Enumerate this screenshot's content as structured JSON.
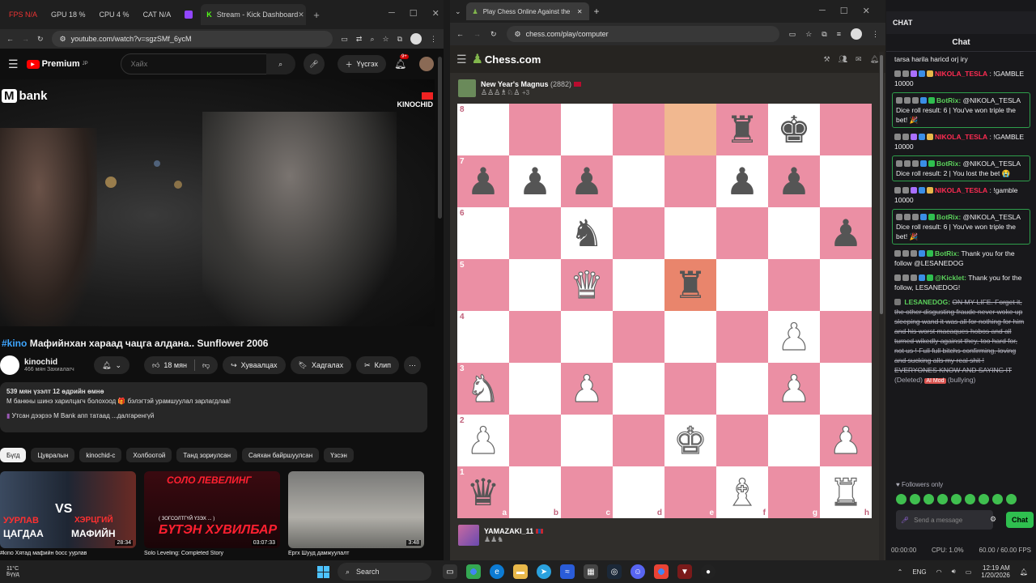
{
  "left_browser": {
    "tabs": [
      "FPS N/A",
      "GPU 18 %",
      "CPU 4 %",
      "CAT N/A",
      "",
      "Stream - Kick Dashboard"
    ],
    "url": "youtube.com/watch?v=sgzSMf_6ycM",
    "yt_logo": "Premium",
    "yt_logo_sup": "JP",
    "search_placeholder": "Хайх",
    "create_label": "Үүсгэх",
    "notif_count": "9+"
  },
  "video": {
    "overlay_brand": "bank",
    "overlay_brand_m": "M",
    "overlay_kinochid": "KINOCHID",
    "hashtag": "#kino",
    "title": "Мафийнхан хараад чацга алдана.. Sunflower 2006",
    "channel": "kinochid",
    "subs": "466 мян Захиалагч",
    "likes": "18 мян",
    "share": "Хуваалцах",
    "save": "Хадгалах",
    "clip": "Клип",
    "views_line": "539 мян үзэлт  12 өдрийн өмнө",
    "desc_line1": "М банкны шинэ харилцагч болохоод 🎁 бэлэгтэй урамшуулал зарлагдлаа!",
    "desc_line2": "Утсан дээрээ M Bank апп татаад ...далгаренгүй"
  },
  "chips": [
    "Бүгд",
    "Цувралын",
    "kinochid-с",
    "Холбоотой",
    "Танд зориулсан",
    "Саяхан байршуулсан",
    "Үзсэн"
  ],
  "thumbs": [
    {
      "title": "#kino Хятад мафийн босс уурлав",
      "duration": "28:34",
      "t1": "УУРЛАВ",
      "t2": "ХЭРЦГИЙ",
      "t3": "ЦАГДАА",
      "t4": "МАФИЙН",
      "vs": "VS"
    },
    {
      "title": "Solo Leveling: Completed Story",
      "duration": "03:07:33",
      "t1": "СОЛО ЛЕВЕЛИНГ",
      "t2": "БҮТЭН ХУВИЛБАР",
      "t3": "( ЗОГСОЛТГҮЙ ҮЗЭХ ... )"
    },
    {
      "title": "Ергх Шууд дамжуулалт",
      "duration": "3:48"
    }
  ],
  "chess_browser": {
    "tab_title": "Play Chess Online Against the C",
    "url": "chess.com/play/computer",
    "logo": "Chess.com",
    "opponent": "New Year's Magnus",
    "opponent_rating": "(2882)",
    "opponent_captures": "+3",
    "player": "YAMAZAKI_11"
  },
  "board": [
    [
      "",
      "",
      "",
      "",
      "hl",
      "bR",
      "bK",
      ""
    ],
    [
      "bP",
      "bP",
      "bP",
      "",
      "",
      "bP",
      "bP",
      ""
    ],
    [
      "",
      "",
      "bN",
      "",
      "",
      "",
      "",
      "bP"
    ],
    [
      "",
      "",
      "wQ",
      "",
      "bR",
      "",
      "",
      ""
    ],
    [
      "",
      "",
      "",
      "",
      "",
      "",
      "wP",
      ""
    ],
    [
      "wN",
      "",
      "wP",
      "",
      "",
      "",
      "wP",
      ""
    ],
    [
      "wP",
      "",
      "",
      "",
      "wK",
      "",
      "",
      "wP"
    ],
    [
      "bQ",
      "",
      "",
      "",
      "",
      "wB",
      "",
      "wR"
    ]
  ],
  "files": [
    "a",
    "b",
    "c",
    "d",
    "e",
    "f",
    "g",
    "h"
  ],
  "ranks": [
    "8",
    "7",
    "6",
    "5",
    "4",
    "3",
    "2",
    "1"
  ],
  "chat": {
    "header": "CHAT",
    "title": "Chat",
    "messages": [
      {
        "name": "",
        "text": "tarsa harila haricd orj iry",
        "highlight": false,
        "kind": "n"
      },
      {
        "name": "NIKOLA_TESLA",
        "text": ": !GAMBLE 10000",
        "highlight": false,
        "kind": "n"
      },
      {
        "name": "BotRix:",
        "text": "@NIKOLA_TESLA Dice roll result: 6 | You've won triple the bet! 🎉",
        "highlight": true,
        "kind": "b"
      },
      {
        "name": "NIKOLA_TESLA",
        "text": ": !GAMBLE 10000",
        "highlight": false,
        "kind": "n"
      },
      {
        "name": "BotRix:",
        "text": "@NIKOLA_TESLA Dice roll result: 2 | You lost the bet 😭",
        "highlight": true,
        "kind": "b"
      },
      {
        "name": "NIKOLA_TESLA",
        "text": ": !gamble 10000",
        "highlight": false,
        "kind": "n"
      },
      {
        "name": "BotRix:",
        "text": "@NIKOLA_TESLA Dice roll result: 6 | You've won triple the bet! 🎉",
        "highlight": true,
        "kind": "b"
      },
      {
        "name": "BotRix:",
        "text": "Thank you for the follow @LESANEDOG",
        "highlight": false,
        "kind": "b"
      },
      {
        "name": "@Kicklet:",
        "text": "Thank you for the follow, LESANEDOG!",
        "highlight": false,
        "kind": "k"
      }
    ],
    "deleted_name": "LESANEDOG:",
    "deleted_text": "ON MY LIFE. Forget it, the other disgusting fraude never woke up sleeping wand it was all for nothing for him and his worst macaques hobos and all turned wikedly against they, too hard for, not us ! Full full bitchs confirming, loving and sucking alls my real shit ! EVERYONES KNOW AND SAYING IT",
    "deleted_tag": "(Deleted)",
    "mod_tag": "AI Mod",
    "mod_reason": "(bullying)",
    "followers_only": "Followers only",
    "input_placeholder": "Send a message",
    "send_label": "Chat",
    "time": "00:00:00",
    "cpu": "CPU: 1.0%",
    "fps": "60.00 / 60.00 FPS"
  },
  "taskbar": {
    "weather_temp": "11°C",
    "weather_text": "Бүүд",
    "search": "Search",
    "lang": "ENG",
    "clock": "12:19 AM",
    "date": "1/20/2026"
  }
}
